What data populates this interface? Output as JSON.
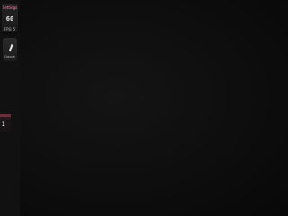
{
  "fps_widget": {
    "title": "Settings",
    "value": "60",
    "caption": "FPS: 5"
  },
  "gauge_widget": {
    "label": "Gauge"
  },
  "bottom_tab": {
    "value": "1"
  },
  "colors": {
    "background": "#0e0e0e",
    "accent": "#ff8aa8",
    "tab_accent": "#6a2d3b"
  }
}
